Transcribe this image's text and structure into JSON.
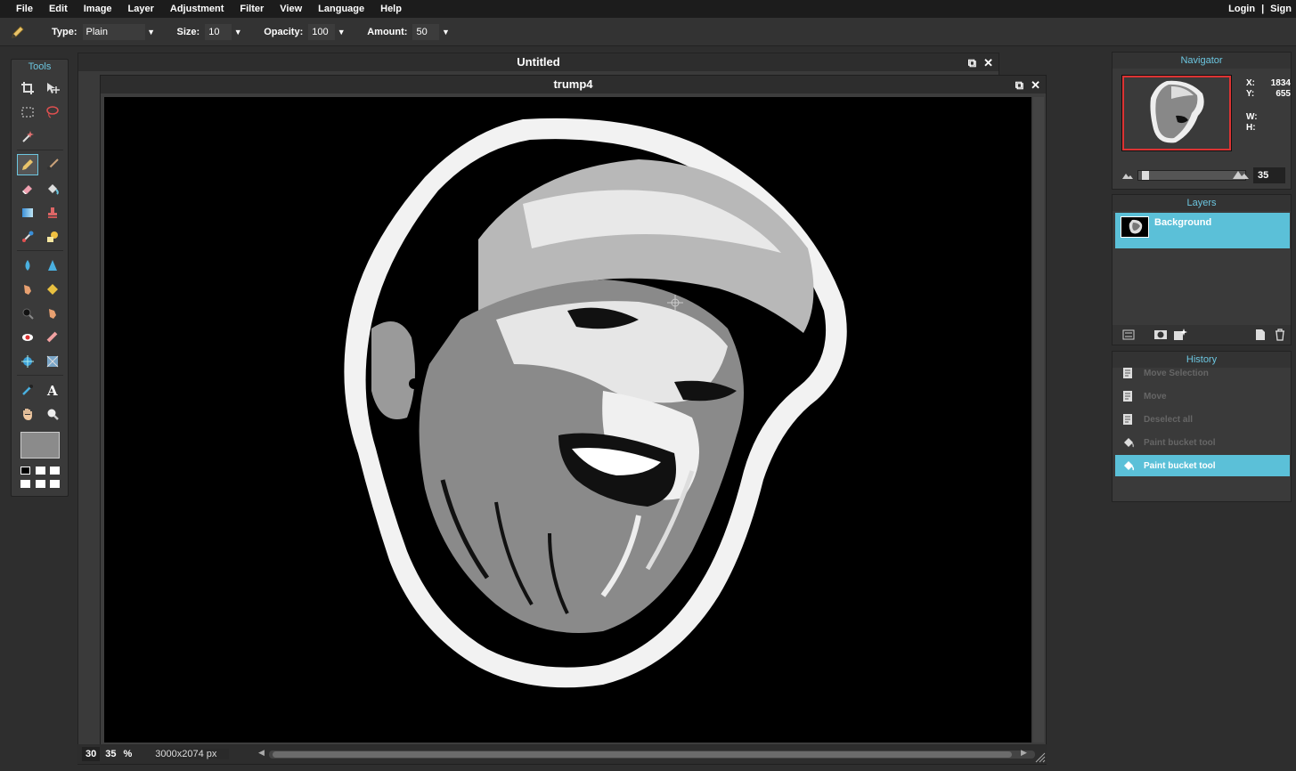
{
  "menu": {
    "items": [
      "File",
      "Edit",
      "Image",
      "Layer",
      "Adjustment",
      "Filter",
      "View",
      "Language",
      "Help"
    ],
    "login": "Login",
    "separator": "|",
    "sign": "Sign"
  },
  "options": {
    "tool_icon": "pencil-icon",
    "type_label": "Type:",
    "type_value": "Plain",
    "size_label": "Size:",
    "size_value": "10",
    "opacity_label": "Opacity:",
    "opacity_value": "100",
    "amount_label": "Amount:",
    "amount_value": "50"
  },
  "tools": {
    "title": "Tools",
    "active": "pencil",
    "foreground_color": "#8b8b8b"
  },
  "windows": {
    "untitled": {
      "title": "Untitled"
    },
    "trump4": {
      "title": "trump4"
    }
  },
  "status": {
    "zoom_value": "30",
    "zoom_value2": "35",
    "zoom_unit": "%",
    "dimensions": "3000x2074 px"
  },
  "navigator": {
    "title": "Navigator",
    "x_label": "X:",
    "x_value": "1834",
    "y_label": "Y:",
    "y_value": "655",
    "w_label": "W:",
    "h_label": "H:",
    "zoom": "35"
  },
  "layers": {
    "title": "Layers",
    "items": [
      {
        "name": "Background"
      }
    ]
  },
  "history": {
    "title": "History",
    "items": [
      {
        "label": "Move Selection",
        "icon": "doc-icon"
      },
      {
        "label": "Move",
        "icon": "doc-icon"
      },
      {
        "label": "Deselect all",
        "icon": "doc-icon"
      },
      {
        "label": "Paint bucket tool",
        "icon": "bucket-icon"
      },
      {
        "label": "Paint bucket tool",
        "icon": "bucket-icon"
      }
    ]
  },
  "colors": {
    "accent": "#6cc6e0",
    "selected_row": "#5bc0d8",
    "nav_frame": "#dd3333"
  }
}
